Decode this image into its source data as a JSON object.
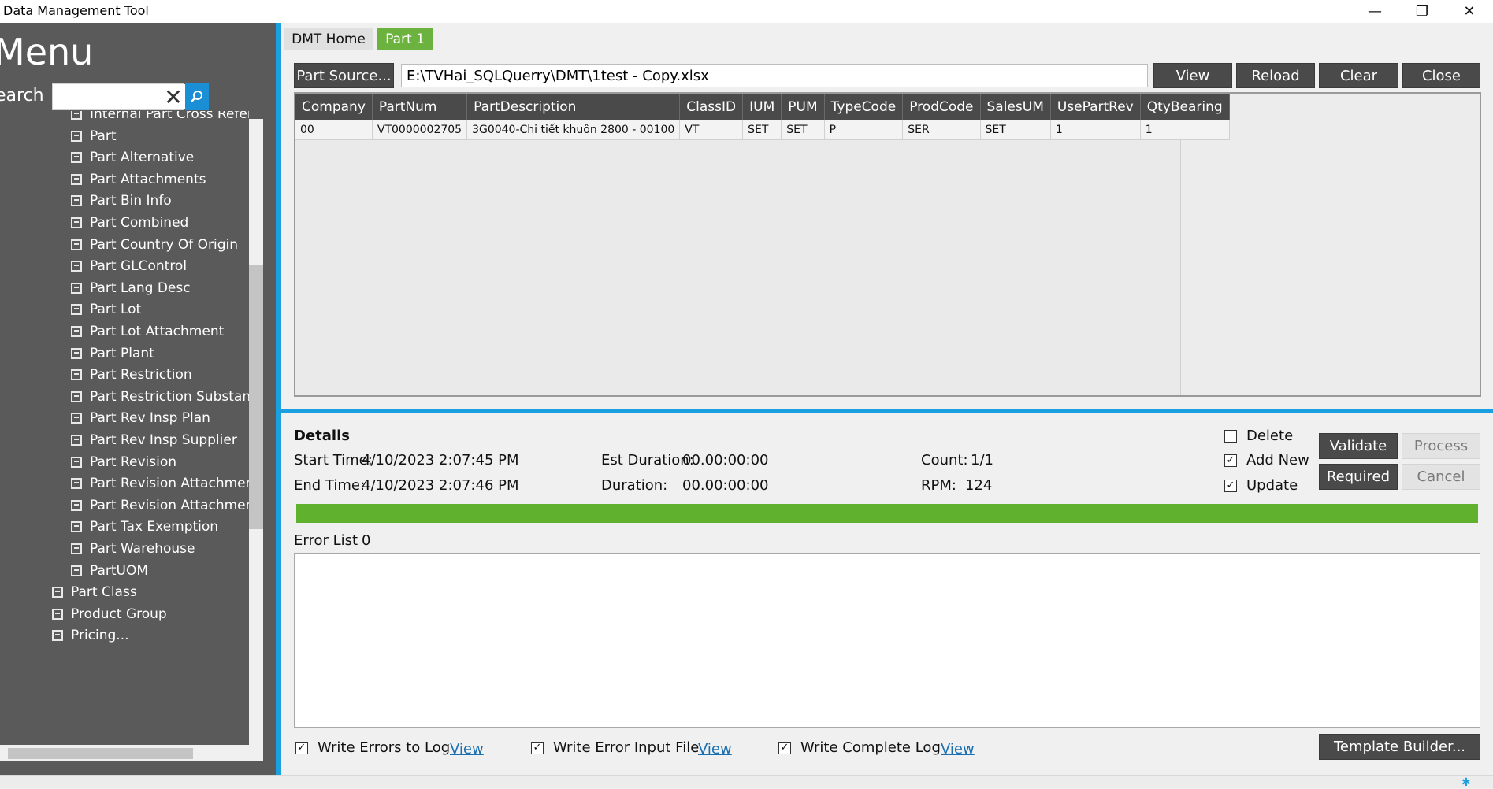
{
  "window": {
    "title": "Data Management Tool",
    "minimize": "—",
    "maximize": "❐",
    "close": "✕"
  },
  "sidebar": {
    "menu_title": "Menu",
    "search_label": "earch",
    "search_value": "",
    "clear_icon": "✕",
    "items": [
      {
        "label": "Internal Part Cross Referenc"
      },
      {
        "label": "Part"
      },
      {
        "label": "Part Alternative"
      },
      {
        "label": "Part Attachments"
      },
      {
        "label": "Part Bin Info"
      },
      {
        "label": "Part Combined"
      },
      {
        "label": "Part Country Of Origin"
      },
      {
        "label": "Part GLControl"
      },
      {
        "label": "Part Lang Desc"
      },
      {
        "label": "Part Lot"
      },
      {
        "label": "Part Lot Attachment"
      },
      {
        "label": "Part Plant"
      },
      {
        "label": "Part Restriction"
      },
      {
        "label": "Part Restriction Substance"
      },
      {
        "label": "Part Rev Insp Plan"
      },
      {
        "label": "Part Rev Insp Supplier"
      },
      {
        "label": "Part Revision"
      },
      {
        "label": "Part Revision Attachment"
      },
      {
        "label": "Part Revision Attachment C"
      },
      {
        "label": "Part Tax Exemption"
      },
      {
        "label": "Part Warehouse"
      },
      {
        "label": "PartUOM"
      },
      {
        "label": "Part Class"
      },
      {
        "label": "Product Group"
      },
      {
        "label": "Pricing..."
      }
    ]
  },
  "tabs": [
    {
      "label": "DMT Home"
    },
    {
      "label": "Part 1"
    }
  ],
  "toolbar": {
    "part_source_label": "Part Source...",
    "file_path": "E:\\TVHai_SQLQuerry\\DMT\\1test - Copy.xlsx",
    "view_label": "View",
    "reload_label": "Reload",
    "clear_label": "Clear",
    "close_label": "Close"
  },
  "grid": {
    "columns": [
      "Company",
      "PartNum",
      "PartDescription",
      "ClassID",
      "IUM",
      "PUM",
      "TypeCode",
      "ProdCode",
      "SalesUM",
      "UsePartRev",
      "QtyBearing"
    ],
    "rows": [
      [
        "00",
        "VT0000002705",
        "3G0040-Chi tiết khuôn 2800 - 00100",
        "VT",
        "SET",
        "SET",
        "P",
        "SER",
        "SET",
        "1",
        "1"
      ]
    ]
  },
  "details": {
    "title": "Details",
    "start_time_label": "Start Time:",
    "start_time": "4/10/2023 2:07:45 PM",
    "end_time_label": "End Time:",
    "end_time": "4/10/2023 2:07:46 PM",
    "est_duration_label": "Est Duration:",
    "est_duration": "00.00:00:00",
    "duration_label": "Duration:",
    "duration": "00.00:00:00",
    "count_label": "Count:",
    "count": "1/1",
    "rpm_label": "RPM:",
    "rpm": "124",
    "progress_percent": 100,
    "delete_label": "Delete",
    "delete_checked": false,
    "add_new_label": "Add New",
    "add_new_checked": true,
    "update_label": "Update",
    "update_checked": true,
    "validate_label": "Validate",
    "process_label": "Process",
    "required_label": "Required",
    "cancel_label": "Cancel",
    "error_list_label": "Error List",
    "error_count": "0"
  },
  "footer": {
    "write_errors_label": "Write Errors to Log",
    "write_errors_checked": true,
    "write_error_input_label": "Write Error Input File",
    "write_error_input_checked": true,
    "write_complete_label": "Write Complete Log",
    "write_complete_checked": true,
    "view_link": "View",
    "template_builder_label": "Template Builder..."
  },
  "colors": {
    "accent_blue": "#1a9fe0",
    "active_tab_green": "#6bb33e",
    "progress_green": "#5fb12e",
    "sidebar_bg": "#5a5a5a",
    "dark_button": "#4a4a4a"
  }
}
